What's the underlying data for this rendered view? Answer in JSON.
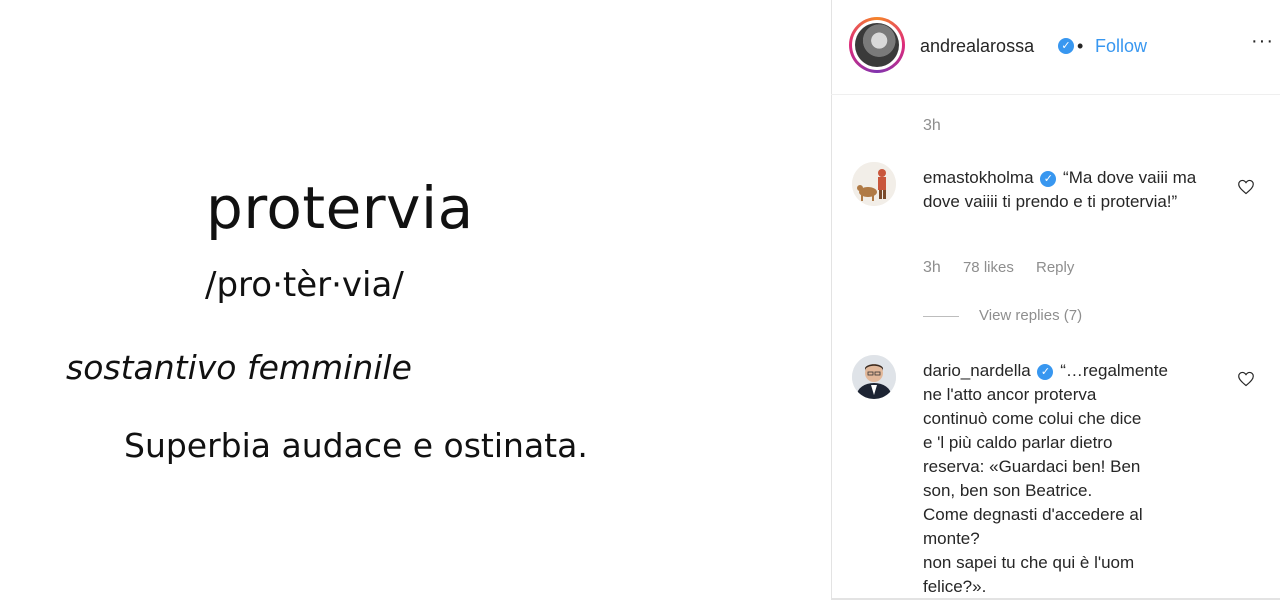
{
  "post": {
    "word": "protervia",
    "phonetic": "/pro·tèr·via/",
    "part_of_speech": "sostantivo femminile",
    "definition": "Superbia audace e ostinata."
  },
  "header": {
    "username": "andrealarossa",
    "separator": "•",
    "follow_label": "Follow",
    "more_label": "···"
  },
  "post_time": "3h",
  "comments": [
    {
      "username": "emastokholma",
      "text": "“Ma dove vaiii ma dove vaiiii ti prendo e ti protervia!”",
      "time": "3h",
      "likes": "78 likes",
      "reply_label": "Reply",
      "view_replies": "View replies (7)"
    },
    {
      "username": "dario_nardella",
      "text_lines": [
        "“…regalmente",
        "ne l'atto ancor proterva",
        "continuò come colui che dice",
        "e 'l più caldo parlar dietro",
        "reserva: «Guardaci ben! Ben",
        "son, ben son Beatrice.",
        "Come degnasti d'accedere al",
        "monte?",
        "non sapei tu che qui è l'uom",
        "felice?»."
      ]
    }
  ],
  "colors": {
    "accent": "#3897f0",
    "muted": "#8e8e8e",
    "text": "#262626"
  },
  "icons": [
    "verified-badge-icon",
    "more-options-icon",
    "heart-icon"
  ]
}
